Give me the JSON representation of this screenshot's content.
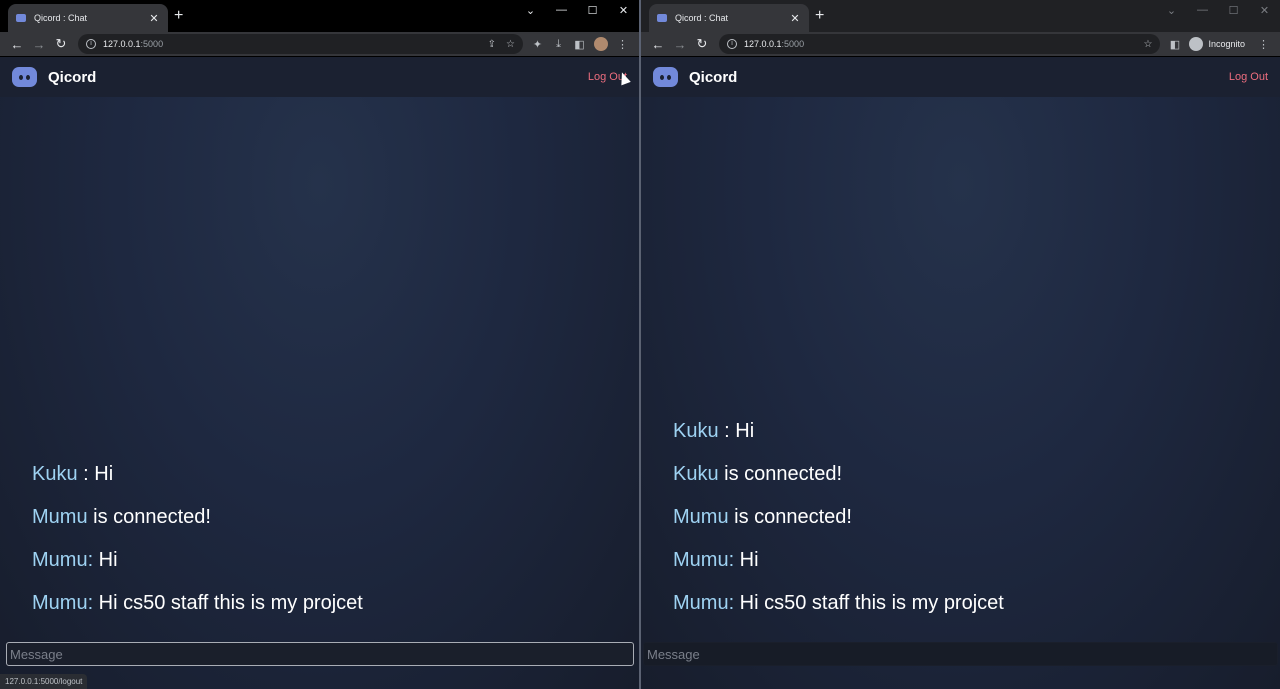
{
  "windows": [
    {
      "tab": {
        "title": "Qicord : Chat",
        "close": "✕"
      },
      "newtab": "+",
      "window_controls": [
        "⌄",
        "—",
        "☐",
        "✕"
      ],
      "url": {
        "host": "127.0.0.1",
        "port": ":5000"
      },
      "app": {
        "name": "Qicord",
        "logout": "Log Out"
      },
      "messages": [
        {
          "user": "Kuku",
          "text": " : Hi"
        },
        {
          "user": "Mumu",
          "text": " is connected!"
        },
        {
          "user": "Mumu:",
          "text": " Hi"
        },
        {
          "user": "Mumu:",
          "text": " Hi cs50 staff this is my projcet"
        }
      ],
      "input_placeholder": "Message",
      "status_url": "127.0.0.1:5000/logout"
    },
    {
      "tab": {
        "title": "Qicord : Chat",
        "close": "✕"
      },
      "newtab": "+",
      "window_controls": [
        "⌄",
        "—",
        "☐",
        "✕"
      ],
      "url": {
        "host": "127.0.0.1",
        "port": ":5000"
      },
      "incognito_label": "Incognito",
      "app": {
        "name": "Qicord",
        "logout": "Log Out"
      },
      "messages": [
        {
          "user": "Kuku",
          "text": " : Hi"
        },
        {
          "user": "Kuku",
          "text": " is connected!"
        },
        {
          "user": "Mumu",
          "text": " is connected!"
        },
        {
          "user": "Mumu:",
          "text": " Hi"
        },
        {
          "user": "Mumu:",
          "text": " Hi cs50 staff this is my projcet"
        }
      ],
      "input_placeholder": "Message"
    }
  ],
  "icons": {
    "back": "←",
    "forward": "→",
    "reload": "↻",
    "share": "⇪",
    "star": "☆",
    "extensions": "✦",
    "download": "⤓",
    "sidepanel": "◧",
    "menu": "⋮"
  },
  "colors": {
    "accent": "#7289da",
    "logout": "#ec6d7e",
    "username": "#9ed2f2"
  }
}
